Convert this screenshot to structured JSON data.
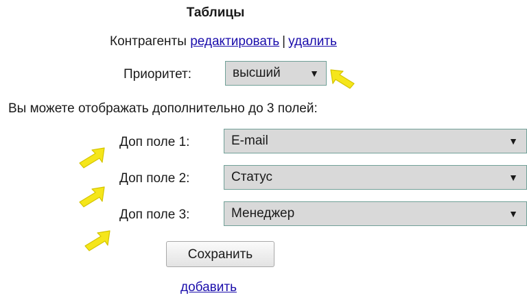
{
  "section_title": "Таблицы",
  "contractors": {
    "label": "Контрагенты",
    "edit_link": "редактировать",
    "separator": "|",
    "delete_link": "удалить"
  },
  "priority": {
    "label": "Приоритет:",
    "value": "высший"
  },
  "extra_fields_info": "Вы можете отображать дополнительно до 3 полей:",
  "extra_fields": [
    {
      "label": "Доп поле 1:",
      "value": "E-mail"
    },
    {
      "label": "Доп поле 2:",
      "value": "Статус"
    },
    {
      "label": "Доп поле 3:",
      "value": "Менеджер"
    }
  ],
  "dropdown_arrow": "▼",
  "save_button": "Сохранить",
  "add_link": "добавить",
  "colors": {
    "link": "#1a0dab",
    "select_bg": "#d9d9d9",
    "select_border": "#6f9f96",
    "pointer_fill": "#f5e61a"
  },
  "icons": {
    "pointer": "hand-pointer-arrow"
  }
}
